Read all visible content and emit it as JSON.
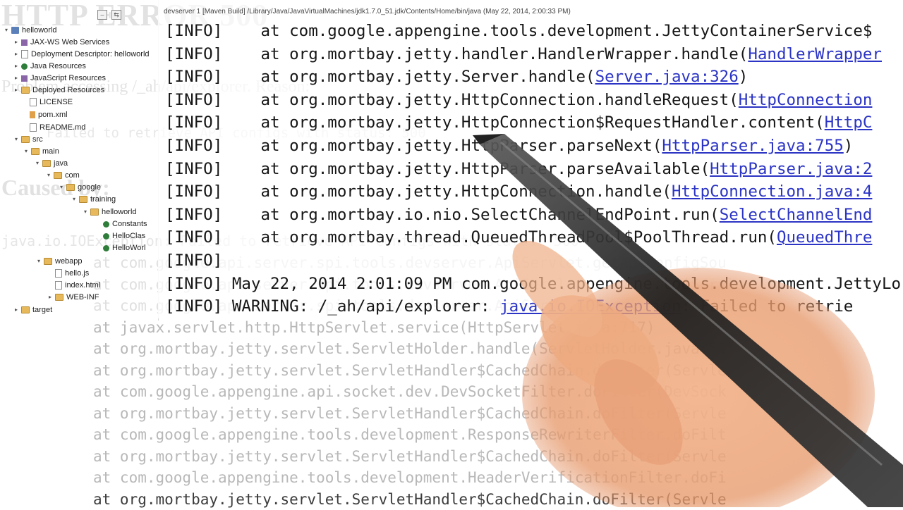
{
  "error_page": {
    "title": "HTTP ERROR 500",
    "problem": "Problem accessing /_ah/api/explorer. Reason:",
    "failed": "Failed to retrieve API configs with status: 500",
    "caused_by": "Caused by:",
    "exception": "java.io.IOException: Failed to retrieve API configs with status: 500",
    "trace": [
      "at com.google.api.server.spi.tools.devserver.ApiServlet.getApiConfigSou",
      "at com.google.api.server.spi.tools.devserver.ApiServlet.service(ApiServle",
      "at com.google.api.server.spi.tools.devserver.ApiServlet.service(ApiServle",
      "at javax.servlet.http.HttpServlet.service(HttpServlet.java:717)",
      "at org.mortbay.jetty.servlet.ServletHolder.handle(ServletHolder.java:51",
      "at org.mortbay.jetty.servlet.ServletHandler$CachedChain.doFilter(Servle",
      "at com.google.appengine.api.socket.dev.DevSocketFilter.doFilter(DevSock",
      "at org.mortbay.jetty.servlet.ServletHandler$CachedChain.doFilter(Servle",
      "at com.google.appengine.tools.development.ResponseRewriterFilter.doFilt",
      "at org.mortbay.jetty.servlet.ServletHandler$CachedChain.doFilter(Servle",
      "at com.google.appengine.tools.development.HeaderVerificationFilter.doFi",
      "at org.mortbay.jetty.servlet.ServletHandler$CachedChain.doFilter(Servle"
    ]
  },
  "explorer": {
    "items": [
      {
        "label": "helloworld",
        "icon": "project-icon"
      },
      {
        "label": "JAX-WS Web Services",
        "icon": "webservices-icon"
      },
      {
        "label": "Deployment Descriptor: helloworld",
        "icon": "descriptor-icon"
      },
      {
        "label": "Java Resources",
        "icon": "java-resources-icon"
      },
      {
        "label": "JavaScript Resources",
        "icon": "javascript-resources-icon"
      },
      {
        "label": "Deployed Resources",
        "icon": "deployed-resources-icon"
      },
      {
        "label": "LICENSE",
        "icon": "file-icon"
      },
      {
        "label": "pom.xml",
        "icon": "xml-file-icon"
      },
      {
        "label": "README.md",
        "icon": "file-icon"
      },
      {
        "label": "src",
        "icon": "folder-icon"
      },
      {
        "label": "main",
        "icon": "folder-icon"
      },
      {
        "label": "java",
        "icon": "folder-icon"
      },
      {
        "label": "com",
        "icon": "folder-icon"
      },
      {
        "label": "google",
        "icon": "folder-icon"
      },
      {
        "label": "training",
        "icon": "folder-icon"
      },
      {
        "label": "helloworld",
        "icon": "folder-icon"
      },
      {
        "label": "Constants",
        "icon": "java-file-icon"
      },
      {
        "label": "HelloClas",
        "icon": "java-file-icon"
      },
      {
        "label": "HelloWorl",
        "icon": "java-file-icon"
      },
      {
        "label": "webapp",
        "icon": "folder-icon"
      },
      {
        "label": "hello.js",
        "icon": "js-file-icon"
      },
      {
        "label": "index.html",
        "icon": "html-file-icon"
      },
      {
        "label": "WEB-INF",
        "icon": "folder-icon"
      },
      {
        "label": "target",
        "icon": "folder-icon"
      }
    ]
  },
  "console": {
    "title": "devserver 1 [Maven Build] /Library/Java/JavaVirtualMachines/jdk1.7.0_51.jdk/Contents/Home/bin/java (May 22, 2014, 2:00:33 PM)",
    "lines": [
      {
        "prefix": "[INFO]    at com.google.appengine.tools.development.JettyContainerService$",
        "link": ""
      },
      {
        "prefix": "[INFO]    at org.mortbay.jetty.handler.HandlerWrapper.handle(",
        "link": "HandlerWrapper"
      },
      {
        "prefix": "[INFO]    at org.mortbay.jetty.Server.handle(",
        "link": "Server.java:326",
        "suffix": ")"
      },
      {
        "prefix": "[INFO]    at org.mortbay.jetty.HttpConnection.handleRequest(",
        "link": "HttpConnection"
      },
      {
        "prefix": "[INFO]    at org.mortbay.jetty.HttpConnection$RequestHandler.content(",
        "link": "HttpC"
      },
      {
        "prefix": "[INFO]    at org.mortbay.jetty.HttpParser.parseNext(",
        "link": "HttpParser.java:755",
        "suffix": ")"
      },
      {
        "prefix": "[INFO]    at org.mortbay.jetty.HttpParser.parseAvailable(",
        "link": "HttpParser.java:2"
      },
      {
        "prefix": "[INFO]    at org.mortbay.jetty.HttpConnection.handle(",
        "link": "HttpConnection.java:4"
      },
      {
        "prefix": "[INFO]    at org.mortbay.io.nio.SelectChannelEndPoint.run(",
        "link": "SelectChannelEnd"
      },
      {
        "prefix": "[INFO]    at org.mortbay.thread.QueuedThreadPool$PoolThread.run(",
        "link": "QueuedThre"
      },
      {
        "prefix": "[INFO]",
        "link": ""
      },
      {
        "prefix": "[INFO] May 22, 2014 2:01:09 PM com.google.appengine.tools.development.JettyLo",
        "link": ""
      },
      {
        "prefix": "[INFO] WARNING: /_ah/api/explorer: ",
        "link": "java.io.IOException",
        "suffix": ": Failed to retrie"
      }
    ]
  },
  "colors": {
    "link": "#2b34c4",
    "console_text": "#161616",
    "faded_text": "#b8b8b8"
  }
}
